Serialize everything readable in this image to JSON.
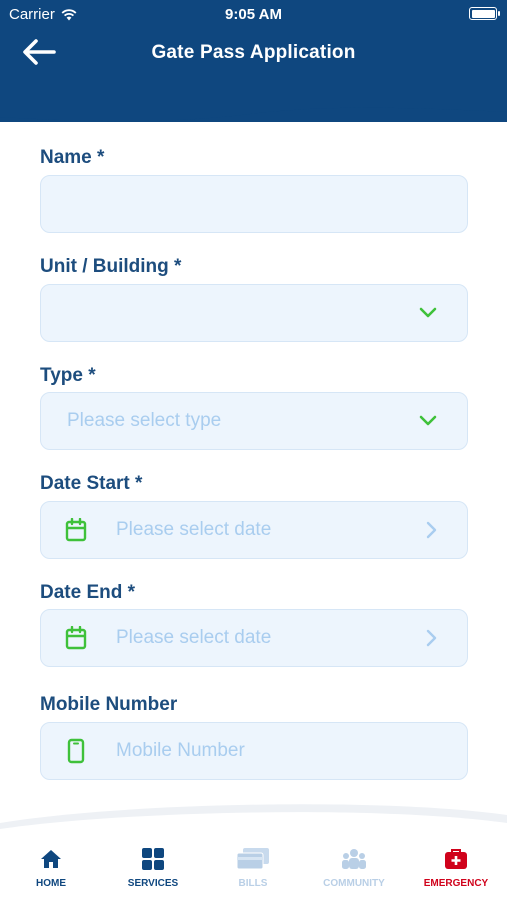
{
  "status": {
    "carrier": "Carrier",
    "time": "9:05 AM"
  },
  "header": {
    "title": "Gate Pass Application"
  },
  "form": {
    "name": {
      "label": "Name *",
      "value": ""
    },
    "unit": {
      "label": "Unit / Building *",
      "value": ""
    },
    "type": {
      "label": "Type *",
      "placeholder": "Please select type"
    },
    "date_start": {
      "label": "Date Start *",
      "placeholder": "Please select date"
    },
    "date_end": {
      "label": "Date End *",
      "placeholder": "Please select date"
    },
    "mobile": {
      "label": "Mobile Number",
      "placeholder": "Mobile Number"
    }
  },
  "nav": [
    {
      "label": "HOME",
      "icon": "home-icon",
      "color": "#0f477f"
    },
    {
      "label": "SERVICES",
      "icon": "grid-icon",
      "color": "#0f477f"
    },
    {
      "label": "BILLS",
      "icon": "cards-icon",
      "color": "#b9cfe6"
    },
    {
      "label": "COMMUNITY",
      "icon": "people-icon",
      "color": "#b9cfe6"
    },
    {
      "label": "EMERGENCY",
      "icon": "medkit-icon",
      "color": "#d0021b"
    }
  ],
  "colors": {
    "header": "#0f477f",
    "accent_green": "#3fc13a",
    "placeholder": "#a9cdef",
    "field_bg": "#edf5fd"
  }
}
